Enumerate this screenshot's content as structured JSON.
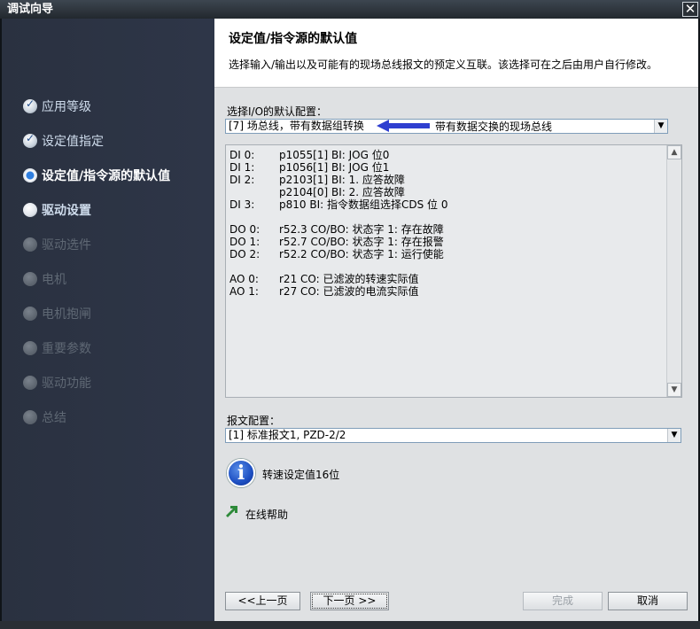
{
  "window": {
    "title": "调试向导",
    "close_glyph": "✕"
  },
  "sidebar": {
    "items": [
      {
        "label": "应用等级",
        "state": "done"
      },
      {
        "label": "设定值指定",
        "state": "done"
      },
      {
        "label": "设定值/指令源的默认值",
        "state": "current"
      },
      {
        "label": "驱动设置",
        "state": "pending"
      },
      {
        "label": "驱动选件",
        "state": "disabled"
      },
      {
        "label": "电机",
        "state": "disabled"
      },
      {
        "label": "电机抱闸",
        "state": "disabled"
      },
      {
        "label": "重要参数",
        "state": "disabled"
      },
      {
        "label": "驱动功能",
        "state": "disabled"
      },
      {
        "label": "总结",
        "state": "disabled"
      }
    ]
  },
  "header": {
    "title": "设定值/指令源的默认值",
    "description": "选择输入/输出以及可能有的现场总线报文的预定义互联。该选择可在之后由用户自行修改。"
  },
  "io_config": {
    "label": "选择I/O的默认配置：",
    "selected": "[7] 场总线，带有数据组转换",
    "annotation": "带有数据交换的现场总线",
    "annotation_color": "#2f3fd0"
  },
  "io_list": [
    {
      "key": "DI 0:",
      "value": "p1055[1] BI: JOG 位0"
    },
    {
      "key": "DI 1:",
      "value": "p1056[1] BI: JOG 位1"
    },
    {
      "key": "DI 2:",
      "value": "p2103[1] BI: 1. 应答故障"
    },
    {
      "key": "",
      "value": "p2104[0] BI: 2. 应答故障"
    },
    {
      "key": "DI 3:",
      "value": "p810 BI: 指令数据组选择CDS 位 0"
    },
    {
      "key": "DO 0:",
      "value": "r52.3 CO/BO: 状态字 1: 存在故障"
    },
    {
      "key": "DO 1:",
      "value": "r52.7 CO/BO: 状态字 1: 存在报警"
    },
    {
      "key": "DO 2:",
      "value": "r52.2 CO/BO: 状态字 1: 运行使能"
    },
    {
      "key": "AO 0:",
      "value": "r21 CO: 已滤波的转速实际值"
    },
    {
      "key": "AO 1:",
      "value": "r27 CO: 已滤波的电流实际值"
    }
  ],
  "telegram": {
    "label": "报文配置：",
    "selected": "[1] 标准报文1, PZD-2/2"
  },
  "info": {
    "text": "转速设定值16位",
    "icon": "info-icon"
  },
  "help": {
    "text": "在线帮助",
    "icon": "arrow-link-icon"
  },
  "buttons": {
    "prev": "<<上一页",
    "next": "下一页 >>",
    "finish": "完成",
    "cancel": "取消"
  }
}
